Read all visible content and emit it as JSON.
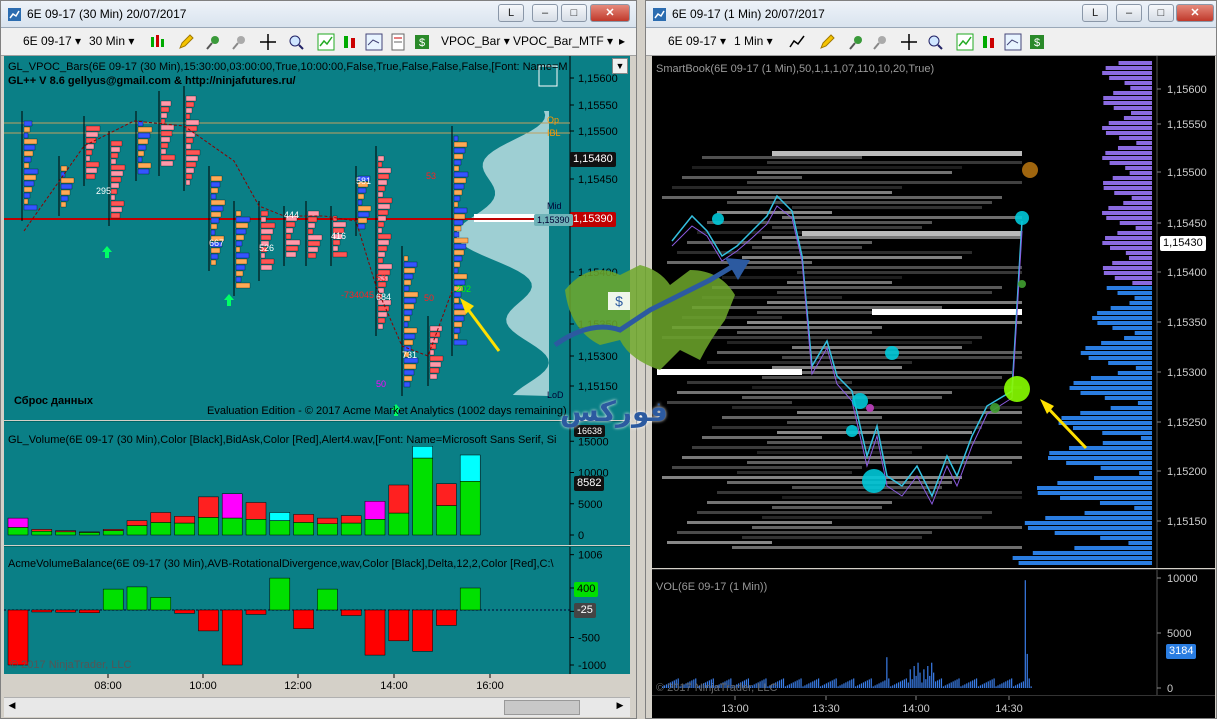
{
  "left_window": {
    "title": "6E 09-17 (30 Min)  20/07/2017",
    "toolbar": {
      "instrument": "6E 09-17",
      "interval": "30 Min",
      "indicator1": "VPOC_Bar",
      "indicator2": "VPOC_Bar_MTF"
    },
    "price_pane": {
      "indicator_label": "GL_VPOC_Bars(6E 09-17 (30 Min),15:30:00,03:00:00,True,10:00:00,False,True,False,False,False,[Font: Name=M",
      "author_label": "GL++ V 8.6 gellyus@gmail.com & http://ninjafutures.ru/",
      "reset_label": "Сброс данных",
      "eval_label": "Evaluation Edition - © 2017 Acme Market Analytics (1002 days remaining)",
      "y_ticks": [
        "1,15600",
        "1,15550",
        "1,15500",
        "1,15450",
        "1,15400",
        "1,15350",
        "1,15300",
        "1,15150"
      ],
      "price_tag_current": "1,15480",
      "price_tag_red": "1,15390",
      "vpoc_small": "1,15390",
      "level_labels": [
        "Op",
        "IBL",
        "Mid",
        "LoD"
      ],
      "bar_labels": [
        "295",
        "667",
        "526",
        "444",
        "416",
        "581",
        "684",
        "731",
        "-734045",
        "53",
        "50",
        "202",
        "53",
        "50"
      ]
    },
    "volume_pane": {
      "indicator_label": "GL_Volume(6E 09-17 (30 Min),Color [Black],BidAsk,Color [Red],Alert4.wav,[Font: Name=Microsoft Sans Serif, Si",
      "y_ticks": [
        "15000",
        "10000",
        "5000",
        "0"
      ],
      "value_tag": "8582",
      "top_tag": "16638"
    },
    "balance_pane": {
      "indicator_label": "AcmeVolumeBalance(6E 09-17 (30 Min),AVB-RotationalDivergence,wav,Color [Black],Delta,12,2,Color [Red],C:\\",
      "copyright": "© 2017 NinjaTrader, LLC",
      "y_ticks": [
        "1006",
        "400",
        "-25",
        "-500",
        "-1000"
      ],
      "value_tag_green": "400",
      "value_tag_gray": "-25"
    },
    "x_ticks": [
      "08:00",
      "10:00",
      "12:00",
      "14:00",
      "16:00"
    ],
    "volume_bars": [
      {
        "total": 2700,
        "green": 1200,
        "top": "magenta"
      },
      {
        "total": 900,
        "green": 600,
        "top": "red"
      },
      {
        "total": 700,
        "green": 500,
        "top": "red"
      },
      {
        "total": 500,
        "green": 400,
        "top": "red"
      },
      {
        "total": 900,
        "green": 700,
        "top": "red"
      },
      {
        "total": 2300,
        "green": 1500,
        "top": "red"
      },
      {
        "total": 3600,
        "green": 2000,
        "top": "red"
      },
      {
        "total": 3000,
        "green": 1900,
        "top": "red"
      },
      {
        "total": 6100,
        "green": 2800,
        "top": "red"
      },
      {
        "total": 6600,
        "green": 2700,
        "top": "magenta"
      },
      {
        "total": 5200,
        "green": 2500,
        "top": "red"
      },
      {
        "total": 3600,
        "green": 2300,
        "top": "cyan"
      },
      {
        "total": 3300,
        "green": 2000,
        "top": "red"
      },
      {
        "total": 2700,
        "green": 1800,
        "top": "red"
      },
      {
        "total": 3100,
        "green": 1900,
        "top": "red"
      },
      {
        "total": 5400,
        "green": 2500,
        "top": "magenta"
      },
      {
        "total": 8000,
        "green": 3500,
        "top": "red"
      },
      {
        "total": 14200,
        "green": 12300,
        "top": "cyan"
      },
      {
        "total": 8200,
        "green": 4700,
        "top": "red"
      },
      {
        "total": 12800,
        "green": 8582,
        "top": "cyan"
      }
    ],
    "balance_bars": [
      -1000,
      -30,
      -40,
      -50,
      380,
      420,
      230,
      -60,
      -380,
      -1000,
      -80,
      580,
      -340,
      380,
      -100,
      -820,
      -560,
      -750,
      -280,
      400
    ]
  },
  "right_window": {
    "title": "6E 09-17 (1 Min)  20/07/2017",
    "toolbar": {
      "instrument": "6E 09-17",
      "interval": "1 Min"
    },
    "smartbook_label": "SmartBook(6E 09-17 (1 Min),50,1,1,1,07,110,10,20,True)",
    "y_ticks": [
      "1,15600",
      "1,15550",
      "1,15500",
      "1,15450",
      "1,15400",
      "1,15350",
      "1,15300",
      "1,15250",
      "1,15200",
      "1,15150"
    ],
    "price_tag": "1,15430",
    "vol_label": "VOL(6E 09-17 (1 Min))",
    "vol_ticks": [
      "10000",
      "5000",
      "0"
    ],
    "vol_tag": "3184",
    "copyright": "© 2017 NinjaTrader, LLC",
    "x_ticks": [
      "13:00",
      "13:30",
      "14:00",
      "14:30"
    ]
  },
  "watermark_text": "فوركس",
  "colors": {
    "teal_bg": "#0a7f86",
    "dark_bg": "#000000",
    "up_green": "#00e000",
    "down_red": "#ff0000",
    "cyan": "#00ffff",
    "magenta": "#ff00ff"
  }
}
